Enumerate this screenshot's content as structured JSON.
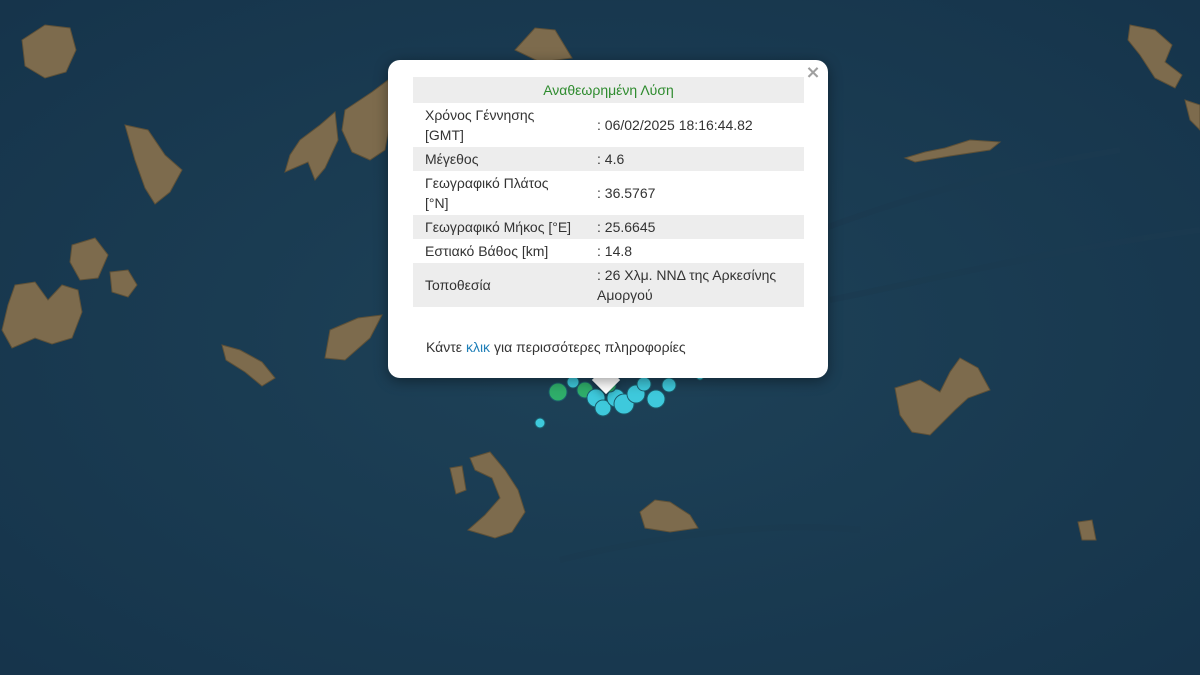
{
  "popup": {
    "title": "Αναθεωρημένη Λύση",
    "close_symbol": "×",
    "rows": [
      {
        "label": "Χρόνος Γέννησης [GMT]",
        "value": ": 06/02/2025 18:16:44.82"
      },
      {
        "label": "Μέγεθος",
        "value": ": 4.6"
      },
      {
        "label": "Γεωγραφικό Πλάτος [°N]",
        "value": ": 36.5767"
      },
      {
        "label": "Γεωγραφικό Μήκος [°E]",
        "value": ": 25.6645"
      },
      {
        "label": "Εστιακό Βάθος [km]",
        "value": ": 14.8"
      },
      {
        "label": "Τοποθεσία",
        "value": ": 26 Χλμ. ΝΝΔ της Αρκεσίνης Αμοργού"
      }
    ],
    "more_prefix": "Κάντε",
    "more_link": "κλικ",
    "more_suffix": "για περισσότερες πληροφορίες"
  },
  "colors": {
    "sea": "#1a3a4f",
    "land": "#7a6a4e",
    "quake_cyan": "#3ec9dc",
    "quake_green": "#2fae6a",
    "title_green": "#2e8b2e",
    "link_blue": "#1f7fb8"
  }
}
